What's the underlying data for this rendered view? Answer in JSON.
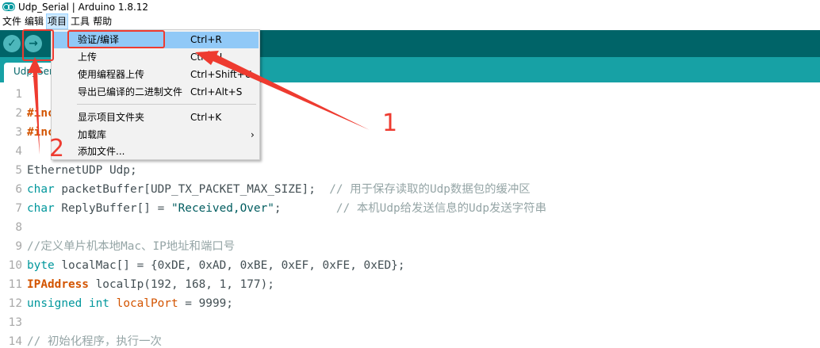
{
  "window": {
    "title": "Udp_Serial | Arduino 1.8.12"
  },
  "menubar": {
    "items": [
      "文件",
      "编辑",
      "项目",
      "工具",
      "帮助"
    ]
  },
  "toolbar": {
    "verify_glyph": "✓",
    "upload_glyph": "→"
  },
  "tab": {
    "label": "Udp_Serial"
  },
  "dropdown": {
    "items": [
      {
        "label": "验证/编译",
        "shortcut": "Ctrl+R"
      },
      {
        "label": "上传",
        "shortcut": "Ctrl+U"
      },
      {
        "label": "使用编程器上传",
        "shortcut": "Ctrl+Shift+U"
      },
      {
        "label": "导出已编译的二进制文件",
        "shortcut": "Ctrl+Alt+S"
      },
      {
        "label": "显示项目文件夹",
        "shortcut": "Ctrl+K"
      },
      {
        "label": "加载库",
        "arrow": "›"
      },
      {
        "label": "添加文件...",
        "shortcut": ""
      }
    ]
  },
  "code_lines": [
    {
      "n": "1",
      "text": ""
    },
    {
      "n": "2",
      "text": "#include <SPI.h>"
    },
    {
      "n": "3",
      "text": "#include <Ethernet.h>"
    },
    {
      "n": "4",
      "text": ""
    },
    {
      "n": "5",
      "text": "EthernetUDP Udp;"
    },
    {
      "n": "6",
      "text": "char packetBuffer[UDP_TX_PACKET_MAX_SIZE];  // 用于保存读取的Udp数据包的缓冲区"
    },
    {
      "n": "7",
      "text": "char ReplyBuffer[] = \"Received,Over\";        // 本机Udp给发送信息的Udp发送字符串"
    },
    {
      "n": "8",
      "text": ""
    },
    {
      "n": "9",
      "text": "//定义单片机本地Mac、IP地址和端口号"
    },
    {
      "n": "10",
      "text": "byte localMac[] = {0xDE, 0xAD, 0xBE, 0xEF, 0xFE, 0xED};"
    },
    {
      "n": "11",
      "text": "IPAddress localIp(192, 168, 1, 177);"
    },
    {
      "n": "12",
      "text": "unsigned int localPort = 9999;"
    },
    {
      "n": "13",
      "text": ""
    },
    {
      "n": "14",
      "text": "// 初始化程序，执行一次"
    }
  ],
  "annotations": {
    "label_1": "1",
    "label_2": "2"
  },
  "colors": {
    "toolbar_bg": "#006468",
    "tabstrip_bg": "#17a1a5",
    "keyword": "#00979c",
    "annotation": "#ee3b30",
    "menu_highlight": "#91c9f7"
  }
}
